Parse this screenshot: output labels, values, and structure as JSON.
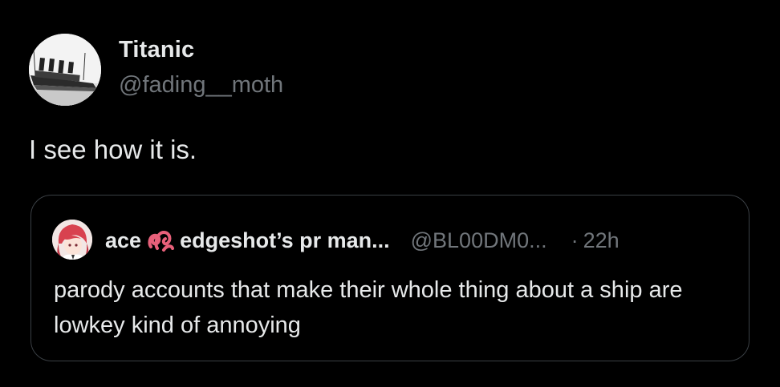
{
  "tweet": {
    "display_name": "Titanic",
    "handle": "@fading__moth",
    "text": "I see how it is."
  },
  "quote": {
    "display_name_part1": "ace",
    "display_name_part2": "edgeshot’s pr man...",
    "handle": "@BL00DM0...",
    "separator": "·",
    "time": "22h",
    "text": "parody accounts that make their whole thing about a ship are lowkey kind of annoying",
    "emoji": "pink-knot-icon"
  },
  "colors": {
    "background": "#000000",
    "primary_text": "#e7e9ea",
    "secondary_text": "#71767b",
    "border": "#3a3f44",
    "emoji_pink": "#e8607a"
  }
}
